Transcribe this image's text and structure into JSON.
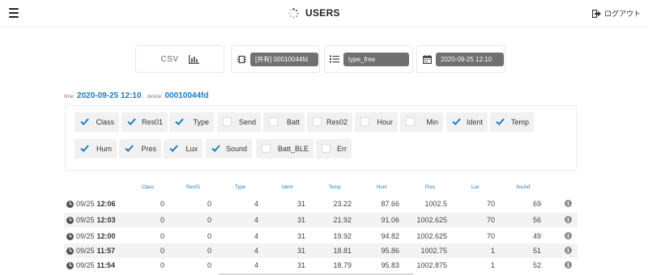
{
  "header": {
    "menu_icon": "hamburger-icon",
    "title": "USERS",
    "title_icon": "spinner-icon",
    "logout_label": "ログアウト",
    "logout_icon": "sign-out-icon"
  },
  "toolbar": {
    "csv_label": "CSV",
    "csv_icon": "bar-chart-icon",
    "device_select": {
      "icon": "chip-icon",
      "value": "[共有] 00010044fd"
    },
    "type_select": {
      "icon": "list-icon",
      "value": "type_free"
    },
    "date_select": {
      "icon": "calendar-icon",
      "value": "2020-09-25 12:10"
    }
  },
  "meta": {
    "time_label": "time:",
    "time_value": "2020-09-25 12:10",
    "device_label": "device:",
    "device_value": "00010044fd"
  },
  "filters": [
    {
      "label": "Class",
      "checked": true
    },
    {
      "label": "Res01",
      "checked": true
    },
    {
      "label": "Type",
      "checked": true
    },
    {
      "label": "Send",
      "checked": false
    },
    {
      "label": "Batt",
      "checked": false
    },
    {
      "label": "Res02",
      "checked": false
    },
    {
      "label": "Hour",
      "checked": false
    },
    {
      "label": "Min",
      "checked": false
    },
    {
      "label": "Ident",
      "checked": true
    },
    {
      "label": "Temp",
      "checked": true
    },
    {
      "label": "Hum",
      "checked": true
    },
    {
      "label": "Pres",
      "checked": true
    },
    {
      "label": "Lux",
      "checked": true
    },
    {
      "label": "Sound",
      "checked": true
    },
    {
      "label": "Batt_BLE",
      "checked": false
    },
    {
      "label": "Err",
      "checked": false
    }
  ],
  "table": {
    "columns": [
      "Class",
      "Res01",
      "Type",
      "Ident",
      "Temp",
      "Hum",
      "Pres",
      "Lux",
      "Sound"
    ],
    "rows": [
      {
        "date": "09/25",
        "time": "12:06",
        "values": [
          "0",
          "0",
          "4",
          "31",
          "23.22",
          "87.66",
          "1002.5",
          "70",
          "69"
        ]
      },
      {
        "date": "09/25",
        "time": "12:03",
        "values": [
          "0",
          "0",
          "4",
          "31",
          "21.92",
          "91.06",
          "1002.625",
          "70",
          "56"
        ]
      },
      {
        "date": "09/25",
        "time": "12:00",
        "values": [
          "0",
          "0",
          "4",
          "31",
          "19.92",
          "94.82",
          "1002.625",
          "70",
          "49"
        ]
      },
      {
        "date": "09/25",
        "time": "11:57",
        "values": [
          "0",
          "0",
          "4",
          "31",
          "18.81",
          "95.86",
          "1002.75",
          "1",
          "51"
        ]
      },
      {
        "date": "09/25",
        "time": "11:54",
        "values": [
          "0",
          "0",
          "4",
          "31",
          "18.79",
          "95.83",
          "1002.875",
          "1",
          "52"
        ]
      }
    ],
    "info_icon": "info-icon"
  },
  "colors": {
    "accent": "#1e7bbf",
    "pill": "#707070",
    "chip_bg": "#f1f1f1",
    "check": "#1e7bbf"
  }
}
